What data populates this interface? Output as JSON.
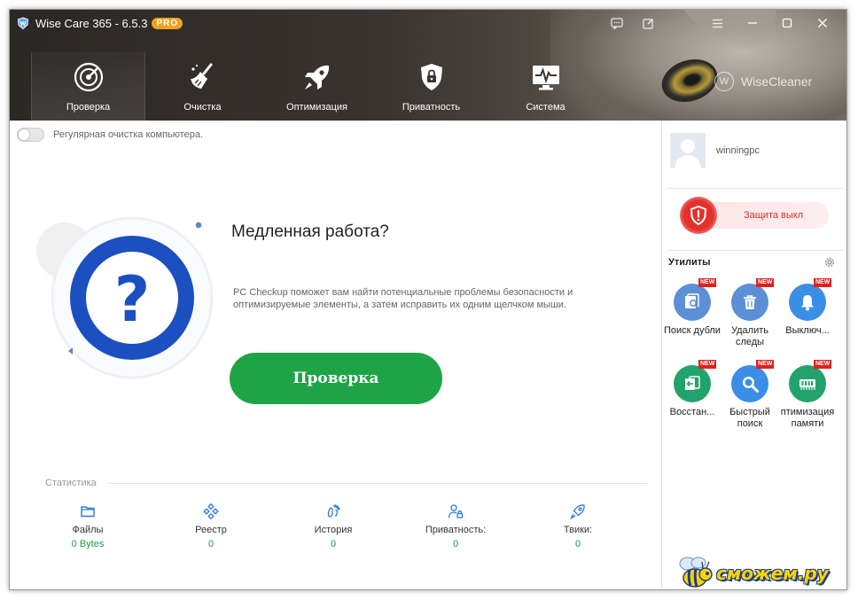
{
  "window": {
    "app_name": "Wise Care 365 - 6.5.3",
    "pro_badge": "PRO",
    "brand": "WiseCleaner",
    "controls": [
      "chat-icon",
      "edit-icon",
      "menu-icon",
      "minimize-icon",
      "maximize-icon",
      "close-icon"
    ]
  },
  "nav": {
    "items": [
      {
        "label": "Проверка",
        "icon": "radar-icon",
        "active": true
      },
      {
        "label": "Очистка",
        "icon": "broom-icon",
        "active": false
      },
      {
        "label": "Оптимизация",
        "icon": "rocket-icon",
        "active": false
      },
      {
        "label": "Приватность",
        "icon": "shield-lock-icon",
        "active": false
      },
      {
        "label": "Система",
        "icon": "monitor-pulse-icon",
        "active": false
      }
    ]
  },
  "main": {
    "auto_clean_label": "Регулярная очистка компьютера.",
    "auto_clean_on": false,
    "hero": {
      "title": "Медленная работа?",
      "description": "PC Checkup поможет вам найти потенциальные проблемы безопасности и оптимизируемые элементы, а затем исправить их одним щелчком мыши.",
      "button": "Проверка"
    },
    "stats": {
      "title": "Статистика",
      "items": [
        {
          "label": "Файлы",
          "value": "0 Bytes",
          "icon": "folder-icon"
        },
        {
          "label": "Реестр",
          "value": "0",
          "icon": "registry-icon"
        },
        {
          "label": "История",
          "value": "0",
          "icon": "footprints-icon"
        },
        {
          "label": "Приватность:",
          "value": "0",
          "icon": "user-lock-icon"
        },
        {
          "label": "Твики:",
          "value": "0",
          "icon": "rocket-small-icon"
        }
      ]
    }
  },
  "sidebar": {
    "username": "winningpc",
    "protection": "Защита выкл",
    "utilities_title": "Утилиты",
    "utilities": [
      {
        "label": "Поиск дублика...",
        "icon": "duplicate-search-icon",
        "badge": "NEW",
        "color": "#5b8fd6"
      },
      {
        "label": "Удалить следы",
        "icon": "trash-icon",
        "badge": "NEW",
        "color": "#5b8fd6"
      },
      {
        "label": "Выключ...",
        "icon": "bell-icon",
        "badge": "NEW",
        "color": "#3a8ee6"
      },
      {
        "label": "Восстан...",
        "icon": "restore-icon",
        "badge": "NEW",
        "color": "#22a36b"
      },
      {
        "label": "Быстрый поиск",
        "icon": "magnifier-icon",
        "badge": "NEW",
        "color": "#3a8ee6"
      },
      {
        "label": "птимизация памяти",
        "icon": "memory-icon",
        "badge": "NEW",
        "color": "#22a36b"
      }
    ]
  },
  "watermark": "сможем.ру"
}
